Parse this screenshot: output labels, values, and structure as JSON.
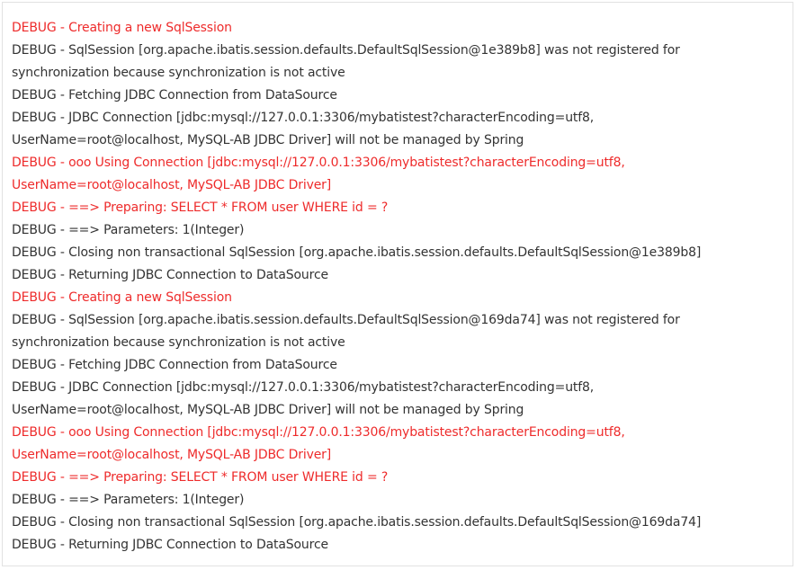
{
  "colors": {
    "normal_text": "#333333",
    "highlight_text": "#ee2b2b",
    "background": "#ffffff",
    "border": "#e2e2e2"
  },
  "log": [
    {
      "text": "DEBUG - Creating a new SqlSession",
      "highlight": true
    },
    {
      "text": "DEBUG - SqlSession [org.apache.ibatis.session.defaults.DefaultSqlSession@1e389b8] was not registered for",
      "highlight": false
    },
    {
      "text": "synchronization because synchronization is not active",
      "highlight": false
    },
    {
      "text": "DEBUG - Fetching JDBC Connection from DataSource",
      "highlight": false
    },
    {
      "text": "DEBUG - JDBC Connection [jdbc:mysql://127.0.0.1:3306/mybatistest?characterEncoding=utf8,",
      "highlight": false
    },
    {
      "text": "UserName=root@localhost, MySQL-AB JDBC Driver] will not be managed by Spring",
      "highlight": false
    },
    {
      "text": "DEBUG - ooo Using Connection [jdbc:mysql://127.0.0.1:3306/mybatistest?characterEncoding=utf8,",
      "highlight": true
    },
    {
      "text": "UserName=root@localhost, MySQL-AB JDBC Driver]",
      "highlight": true
    },
    {
      "text": "DEBUG - ==>  Preparing: SELECT * FROM user WHERE id = ?",
      "highlight": true
    },
    {
      "text": "DEBUG - ==> Parameters: 1(Integer)",
      "highlight": false
    },
    {
      "text": "DEBUG - Closing non transactional SqlSession [org.apache.ibatis.session.defaults.DefaultSqlSession@1e389b8]",
      "highlight": false
    },
    {
      "text": "DEBUG - Returning JDBC Connection to DataSource",
      "highlight": false
    },
    {
      "text": "DEBUG - Creating a new SqlSession",
      "highlight": true
    },
    {
      "text": "DEBUG - SqlSession [org.apache.ibatis.session.defaults.DefaultSqlSession@169da74] was not registered for",
      "highlight": false
    },
    {
      "text": "synchronization because synchronization is not active",
      "highlight": false
    },
    {
      "text": "DEBUG - Fetching JDBC Connection from DataSource",
      "highlight": false
    },
    {
      "text": "DEBUG - JDBC Connection [jdbc:mysql://127.0.0.1:3306/mybatistest?characterEncoding=utf8,",
      "highlight": false
    },
    {
      "text": "UserName=root@localhost, MySQL-AB JDBC Driver] will not be managed by Spring",
      "highlight": false
    },
    {
      "text": "DEBUG - ooo Using Connection [jdbc:mysql://127.0.0.1:3306/mybatistest?characterEncoding=utf8,",
      "highlight": true
    },
    {
      "text": "UserName=root@localhost, MySQL-AB JDBC Driver]",
      "highlight": true
    },
    {
      "text": "DEBUG - ==>  Preparing: SELECT * FROM user WHERE id = ?",
      "highlight": true
    },
    {
      "text": "DEBUG - ==> Parameters: 1(Integer)",
      "highlight": false
    },
    {
      "text": "DEBUG - Closing non transactional SqlSession [org.apache.ibatis.session.defaults.DefaultSqlSession@169da74]",
      "highlight": false
    },
    {
      "text": "DEBUG - Returning JDBC Connection to DataSource",
      "highlight": false
    }
  ]
}
